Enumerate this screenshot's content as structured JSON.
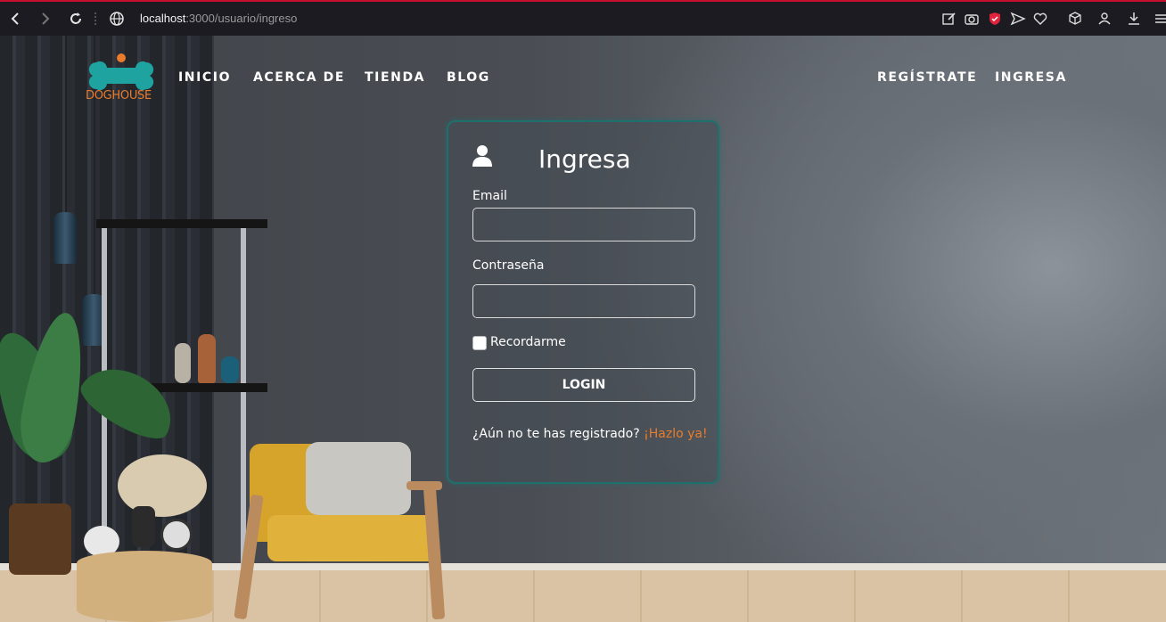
{
  "browser": {
    "url_host": "localhost",
    "url_path": ":3000/usuario/ingreso",
    "icons": [
      "back-icon",
      "forward-icon",
      "reload-icon",
      "site-info-icon",
      "edit-icon",
      "camera-icon",
      "shield-icon",
      "send-icon",
      "heart-icon",
      "box-icon",
      "profile-icon",
      "download-icon",
      "menu-icon"
    ],
    "accent_color": "#c8102e"
  },
  "site": {
    "logo_text": "DOGHOUSE",
    "brand_color": "#e87c2b",
    "logo_color": "#1fa3a1",
    "nav": {
      "inicio": "INICIO",
      "acerca": "ACERCA DE",
      "tienda": "TIENDA",
      "blog": "BLOG",
      "registrate": "REGÍSTRATE",
      "ingresa": "INGRESA"
    }
  },
  "login": {
    "title": "Ingresa",
    "email_label": "Email",
    "email_value": "",
    "password_label": "Contraseña",
    "password_value": "",
    "remember_label": "Recordarme",
    "remember_checked": false,
    "submit_label": "LOGIN",
    "register_prompt": "¿Aún no te has registrado?",
    "register_link": "¡Hazlo ya!",
    "border_color": "#1f6f6c"
  }
}
